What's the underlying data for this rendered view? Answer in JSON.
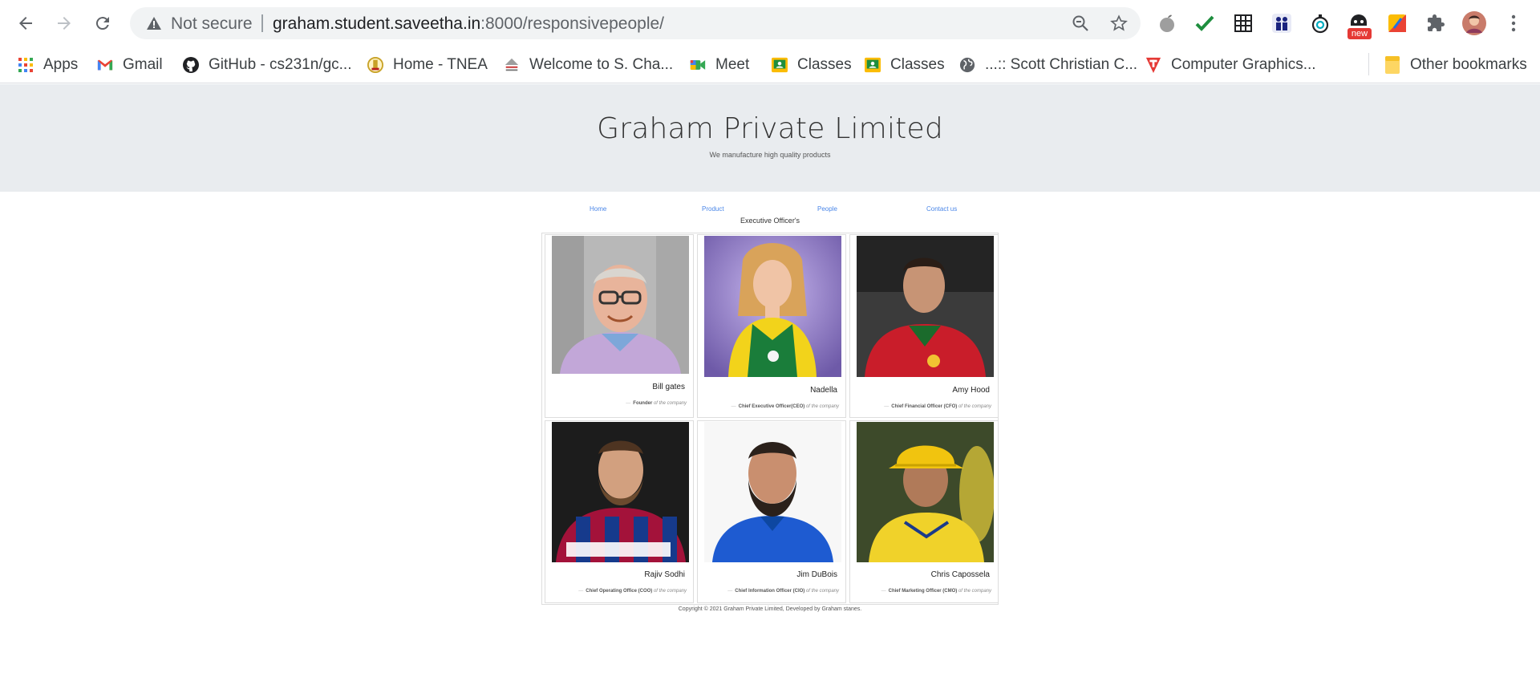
{
  "browser": {
    "security_label": "Not secure",
    "url_host": "graham.student.saveetha.in",
    "url_rest": ":8000/responsivepeople/",
    "ext_badge": "new",
    "bookmarks": [
      {
        "label": "Apps",
        "icon": "apps-grid-icon"
      },
      {
        "label": "Gmail",
        "icon": "gmail-icon"
      },
      {
        "label": "GitHub - cs231n/gc...",
        "icon": "github-icon"
      },
      {
        "label": "Home - TNEA",
        "icon": "tnea-emblem-icon"
      },
      {
        "label": "Welcome to S. Cha...",
        "icon": "college-logo-icon"
      },
      {
        "label": "Meet",
        "icon": "meet-icon"
      },
      {
        "label": "Classes",
        "icon": "classroom-icon"
      },
      {
        "label": "Classes",
        "icon": "classroom-icon"
      },
      {
        "label": "...:: Scott Christian C...",
        "icon": "globe-icon"
      },
      {
        "label": "Computer Graphics...",
        "icon": "tutorialspoint-icon"
      }
    ],
    "other_bookmarks": "Other bookmarks"
  },
  "page": {
    "title": "Graham Private Limited",
    "subtitle": "We manufacture high quality products",
    "nav": [
      "Home",
      "Product",
      "People",
      "Contact us"
    ],
    "section_label": "Executive Officer's",
    "people": [
      {
        "name": "Bill gates",
        "role": "Founder",
        "suffix": "of the company"
      },
      {
        "name": "Nadella",
        "role": "Chief Executive Officer(CEO)",
        "suffix": "of the company"
      },
      {
        "name": "Amy Hood",
        "role": "Chief Financial Officer (CFO)",
        "suffix": "of the company"
      },
      {
        "name": "Rajiv Sodhi",
        "role": "Chief Operating Office (COO)",
        "suffix": "of the company"
      },
      {
        "name": "Jim DuBois",
        "role": "Chief Information Officer (CIO)",
        "suffix": "of the company"
      },
      {
        "name": "Chris Capossela",
        "role": "Chief Marketing Officer (CMO)",
        "suffix": "of the company"
      }
    ],
    "copyright": "Copyright © 2021 Graham Private Limited, Developed by Graham stanes."
  },
  "colors": {
    "hero_bg": "#e9ecef",
    "link": "#4a86e8",
    "omnibox": "#f1f3f4"
  }
}
